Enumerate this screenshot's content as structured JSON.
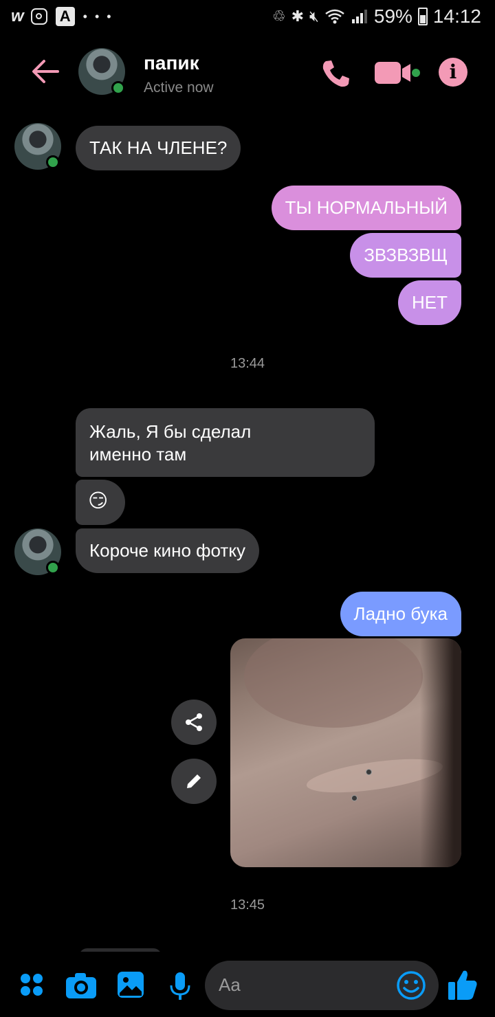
{
  "status_bar": {
    "app_w": "w",
    "app_a": "A",
    "dots": "• • •",
    "battery": "59%",
    "time": "14:12"
  },
  "header": {
    "name": "папик",
    "status": "Active now",
    "info_glyph": "i",
    "accent_color": "#f39ab6",
    "online_color": "#31a24c"
  },
  "messages": [
    {
      "from": "them",
      "text": "ТАК НА ЧЛЕНЕ?"
    },
    {
      "from": "me",
      "text": "ТЫ НОРМАЛЬНЫЙ"
    },
    {
      "from": "me",
      "text": "ЗВЗВЗВЩ"
    },
    {
      "from": "me",
      "text": "НЕТ"
    },
    {
      "timestamp": "13:44"
    },
    {
      "from": "them",
      "text_line1": "Жаль, Я бы сделал",
      "text_line2": "именно там"
    },
    {
      "from": "them",
      "text": "😏"
    },
    {
      "from": "them",
      "text": "Короче кино фотку"
    },
    {
      "from": "me",
      "text": "Ладно бука"
    },
    {
      "from": "me",
      "type": "photo",
      "description": "photo"
    },
    {
      "timestamp": "13:45"
    }
  ],
  "composer": {
    "placeholder": "Aa",
    "icons": [
      "apps-icon",
      "camera-icon",
      "gallery-icon",
      "mic-icon",
      "emoji-icon",
      "thumbs-up-icon"
    ],
    "icon_color": "#0a9cf7"
  }
}
